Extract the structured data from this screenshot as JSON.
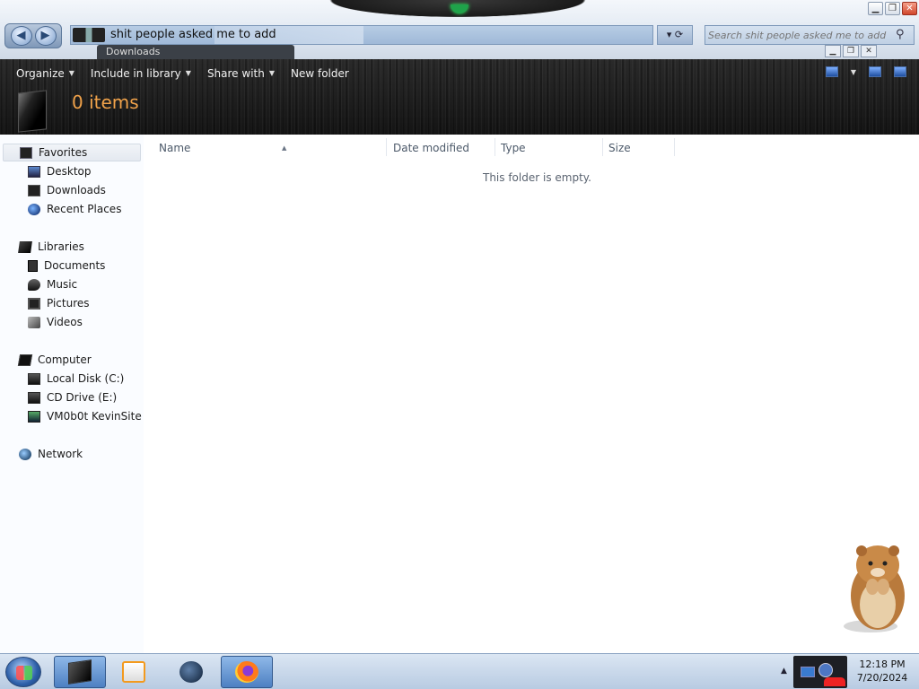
{
  "window": {
    "controls": {
      "minimize": "▁",
      "maximize": "❐",
      "close": "✕"
    },
    "ghost_tab_label": "Downloads",
    "ghost_controls": {
      "minimize": "▁",
      "maximize": "❐",
      "close": "✕"
    }
  },
  "navigation": {
    "back_label": "◀",
    "forward_label": "▶"
  },
  "address_bar": {
    "path": "shit people asked me to add",
    "dropdown_label": "▾ ⟳"
  },
  "search": {
    "placeholder": "Search shit people asked me to add",
    "icon": "search-icon"
  },
  "toolbar": {
    "items": [
      {
        "label": "Organize",
        "dropdown": true
      },
      {
        "label": "Include in library",
        "dropdown": true
      },
      {
        "label": "Share with",
        "dropdown": true
      },
      {
        "label": "New folder",
        "dropdown": false
      }
    ],
    "view_caret": "▼"
  },
  "header": {
    "items_count": "0 items"
  },
  "sidebar": {
    "favorites": {
      "label": "Favorites",
      "items": [
        "Desktop",
        "Downloads",
        "Recent Places"
      ]
    },
    "libraries": {
      "label": "Libraries",
      "items": [
        "Documents",
        "Music",
        "Pictures",
        "Videos"
      ]
    },
    "computer": {
      "label": "Computer",
      "items": [
        "Local Disk (C:)",
        "CD Drive (E:)",
        "VM0b0t KevinSite"
      ]
    },
    "network": {
      "label": "Network"
    }
  },
  "columns": {
    "name": "Name",
    "date_modified": "Date modified",
    "type": "Type",
    "size": "Size",
    "sort_arrow": "▲"
  },
  "content": {
    "empty_message": "This folder is empty."
  },
  "taskbar": {
    "clock_time": "12:18 PM",
    "clock_date": "7/20/2024",
    "tray_arrow": "▲",
    "apps": [
      "explorer",
      "media-player",
      "internet-browser",
      "firefox"
    ]
  }
}
